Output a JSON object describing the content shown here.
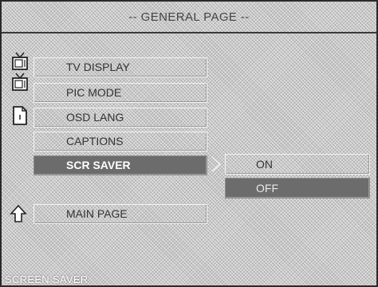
{
  "header": {
    "title": "-- GENERAL PAGE --"
  },
  "menu": {
    "items": [
      {
        "label": "TV DISPLAY",
        "icon": "tv-icon"
      },
      {
        "label": "PIC MODE",
        "icon": "tv-icon"
      },
      {
        "label": "OSD LANG",
        "icon": "document-icon"
      },
      {
        "label": "CAPTIONS",
        "icon": ""
      },
      {
        "label": "SCR SAVER",
        "icon": "",
        "selected": true
      },
      {
        "label": "MAIN PAGE",
        "icon": "up-arrow-icon"
      }
    ]
  },
  "submenu": {
    "options": [
      {
        "label": "ON",
        "selected": false
      },
      {
        "label": "OFF",
        "selected": true
      }
    ]
  },
  "status": {
    "text": "SCREEN SAVER"
  },
  "colors": {
    "background": "#c8c8c8",
    "highlight": "#6c6c6c",
    "text": "#333333"
  }
}
